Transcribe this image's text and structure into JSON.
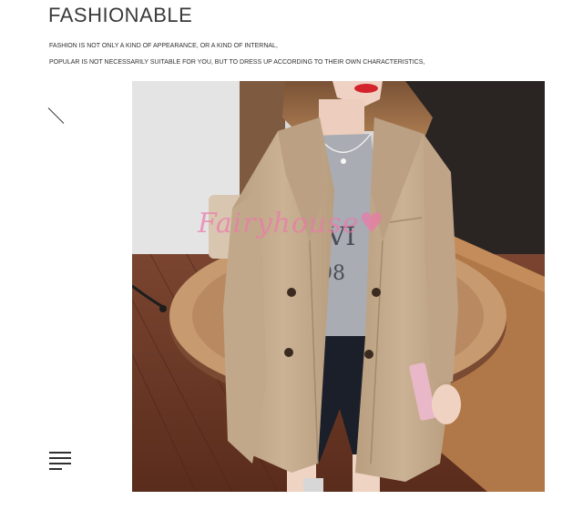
{
  "header": {
    "title": "FASHIONABLE",
    "description_lines": [
      "FASHION IS NOT ONLY A KIND OF APPEARANCE, OR A KIND OF INTERNAL,",
      "POPULAR IS NOT NECESSARILY SUITABLE FOR YOU, BUT TO DRESS UP ACCORDING TO THEIR OWN CHARACTERISTICS,"
    ]
  },
  "photo": {
    "watermark": "Fairyhouse♥",
    "subject": "model-wearing-khaki-double-breasted-blazer",
    "shirt_print": [
      "VI",
      "98"
    ],
    "colors": {
      "blazer": "#c6ad8e",
      "shirt": "#a9acb2",
      "floor": "#6e3b28",
      "table": "#c79a72",
      "wall": "#d8d8d8",
      "dark_background": "#2b2422",
      "watermark": "#ec78aa"
    }
  },
  "icons": {
    "diagonal": "diagonal-line-icon",
    "menu": "menu-lines-icon"
  }
}
